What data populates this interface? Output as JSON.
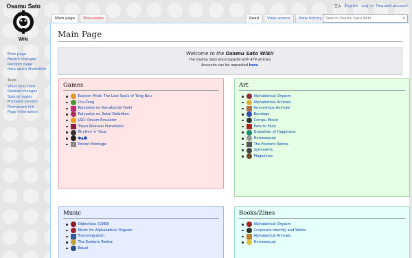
{
  "logo": {
    "title": "Osamu Sato",
    "subtitle": "Wiki"
  },
  "personal": {
    "language": "English",
    "login": "Log in",
    "request": "Request account"
  },
  "sidebar": {
    "nav": [
      "Main page",
      "Recent changes",
      "Random page",
      "Help about MediaWiki"
    ],
    "tools_heading": "Tools",
    "tools": [
      "What links here",
      "Related changes",
      "Special pages",
      "Printable version",
      "Permanent link",
      "Page information"
    ]
  },
  "tabs": {
    "main": "Main page",
    "discussion": "Discussion",
    "read": "Read",
    "view_source": "View source",
    "view_history": "View history"
  },
  "search": {
    "placeholder": "Search Osamu Sato Wiki"
  },
  "page": {
    "title": "Main Page"
  },
  "welcome": {
    "prefix": "Welcome to the ",
    "site": "Osamu Sato Wiki!",
    "line2": "The Osamu Sato encyclopedia with 479 articles.",
    "line3_prefix": "Accounts can be requested ",
    "line3_link": "here",
    "line3_suffix": "."
  },
  "games": {
    "heading": "Games",
    "items": [
      {
        "label": "Eastern Mind: The Lost Souls of Tong-Nou",
        "color": "#d89b2a"
      },
      {
        "label": "Chu-Teng",
        "color": "#4a8f3a"
      },
      {
        "label": "Rolypolys no Nanakorobi Yaoki",
        "color": "#c02a7a"
      },
      {
        "label": "Rolypolys no Sekai Daibōken",
        "color": "#b3305a"
      },
      {
        "label": "LSD: Dream Emulator",
        "color": "#e8a020"
      },
      {
        "label": "Tokyo Wakusei Planetokio",
        "color": "#8a2040"
      },
      {
        "label": "Rhythm 'n' Face",
        "color": "#333333"
      },
      {
        "label": "●▲■",
        "color": "#222222"
      },
      {
        "label": "Pocket Montage",
        "color": "#8a8a8a"
      }
    ]
  },
  "art": {
    "heading": "Art",
    "items": [
      {
        "label": "Alphabetical Orgasm",
        "color": "#8a2a3a"
      },
      {
        "label": "Alphabetical Animals",
        "color": "#d8b040"
      },
      {
        "label": "Anonymous Animals",
        "color": "#b07050"
      },
      {
        "label": "Bondage",
        "color": "#3050b0"
      },
      {
        "label": "Compu Movie",
        "color": "#333333"
      },
      {
        "label": "Face to Face",
        "color": "#b02020"
      },
      {
        "label": "Gradation of Happiness",
        "color": "#208a70"
      },
      {
        "label": "Homosexual",
        "color": "#999999"
      },
      {
        "label": "The Esoteric Retina",
        "color": "#555555"
      },
      {
        "label": "Symmetric",
        "color": "#444444"
      },
      {
        "label": "Magazines",
        "color": "#6a4a2a"
      }
    ]
  },
  "music": {
    "heading": "Music",
    "items": [
      {
        "label": "Objectless (1983)",
        "color": "#8a1a2a"
      },
      {
        "label": "Music for Alphabetical Orgasm",
        "color": "#a02030"
      },
      {
        "label": "Transmigration",
        "color": "#3a5aa0"
      },
      {
        "label": "The Esoteric Retina",
        "color": "#c0a030"
      },
      {
        "label": "Equal",
        "color": "#2a4a8a"
      }
    ]
  },
  "books": {
    "heading": "Books/Zines",
    "items": [
      {
        "label": "Alphabetical Orgasm",
        "color": "#a02020"
      },
      {
        "label": "Corporate Identity and Works",
        "color": "#303030"
      },
      {
        "label": "Alphabetical Animals",
        "color": "#c08030"
      },
      {
        "label": "Homosexual",
        "color": "#e0c040"
      }
    ]
  }
}
